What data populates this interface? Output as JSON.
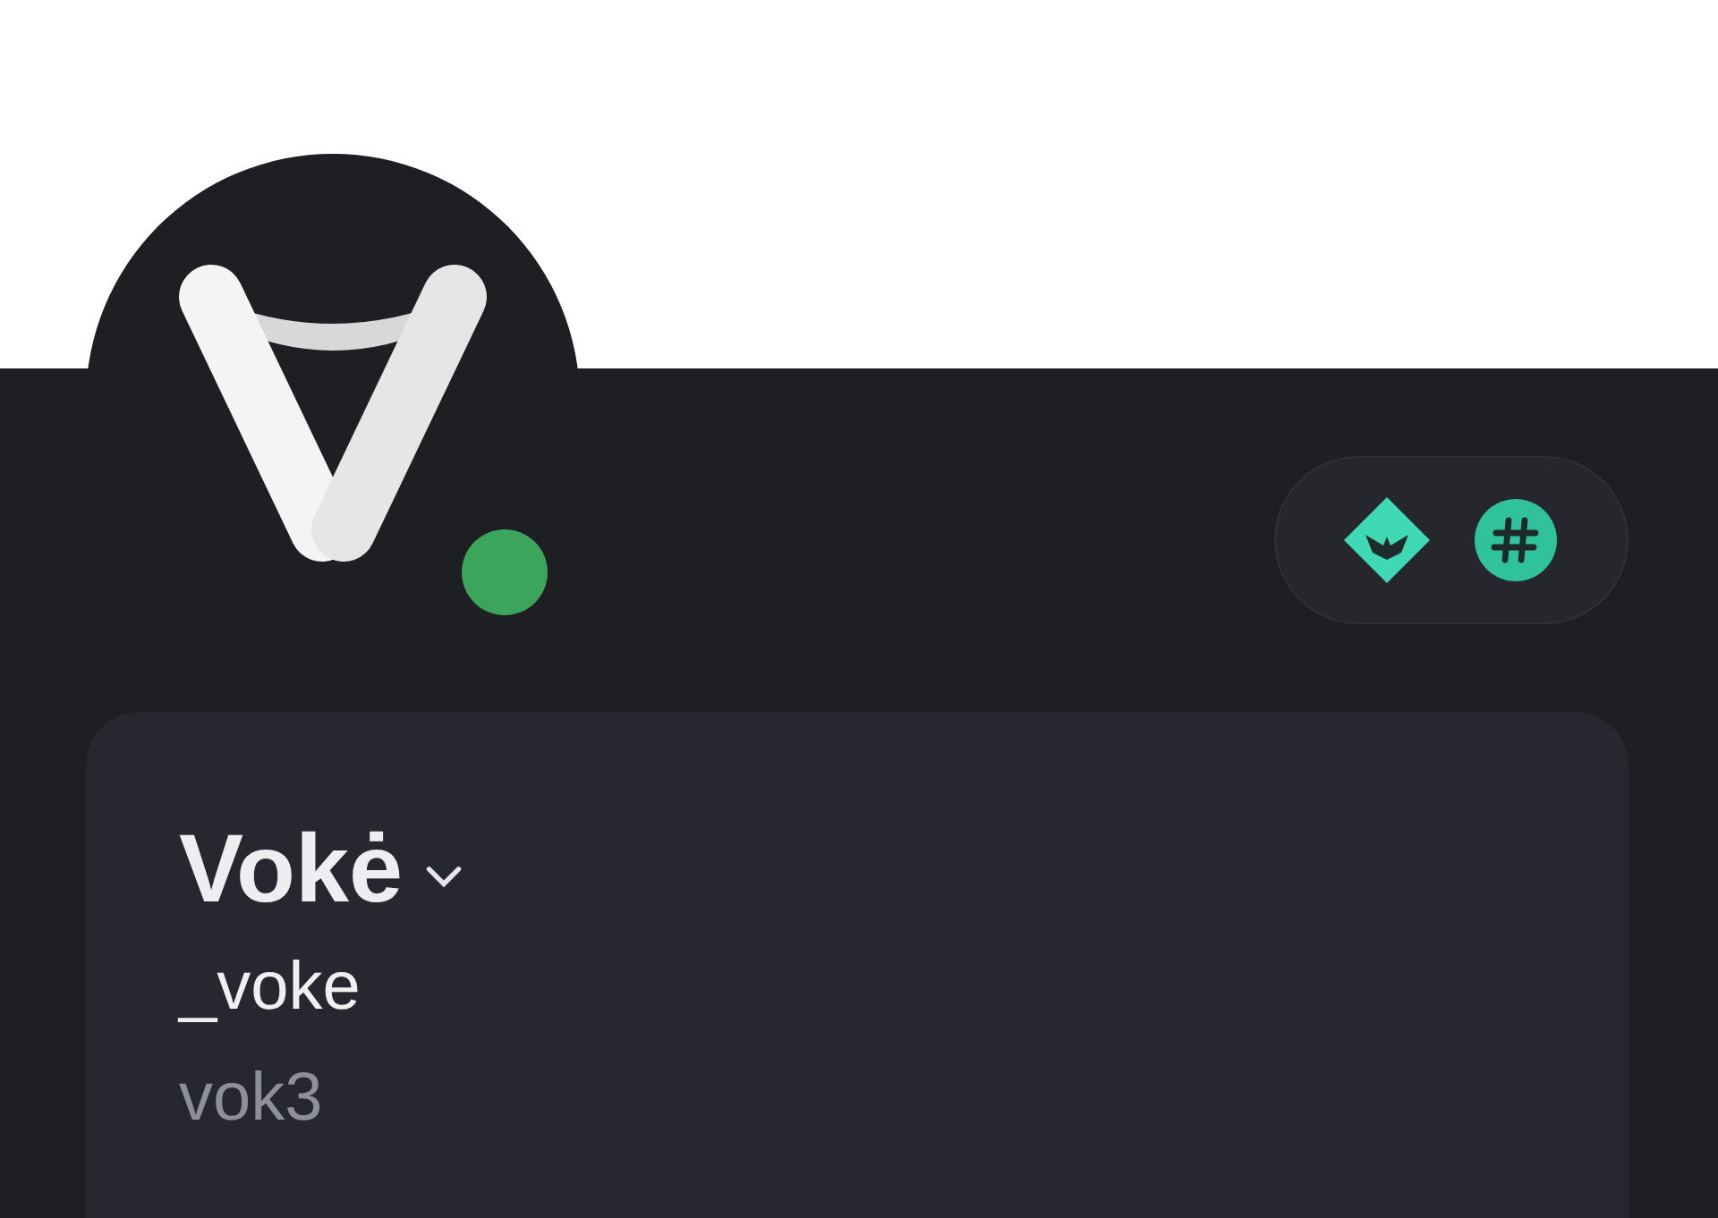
{
  "profile": {
    "online": true,
    "display_name": "Vokė",
    "username": "_voke",
    "pronouns": "vok3"
  },
  "badges": [
    {
      "kind": "diamond"
    },
    {
      "kind": "hash"
    }
  ]
}
